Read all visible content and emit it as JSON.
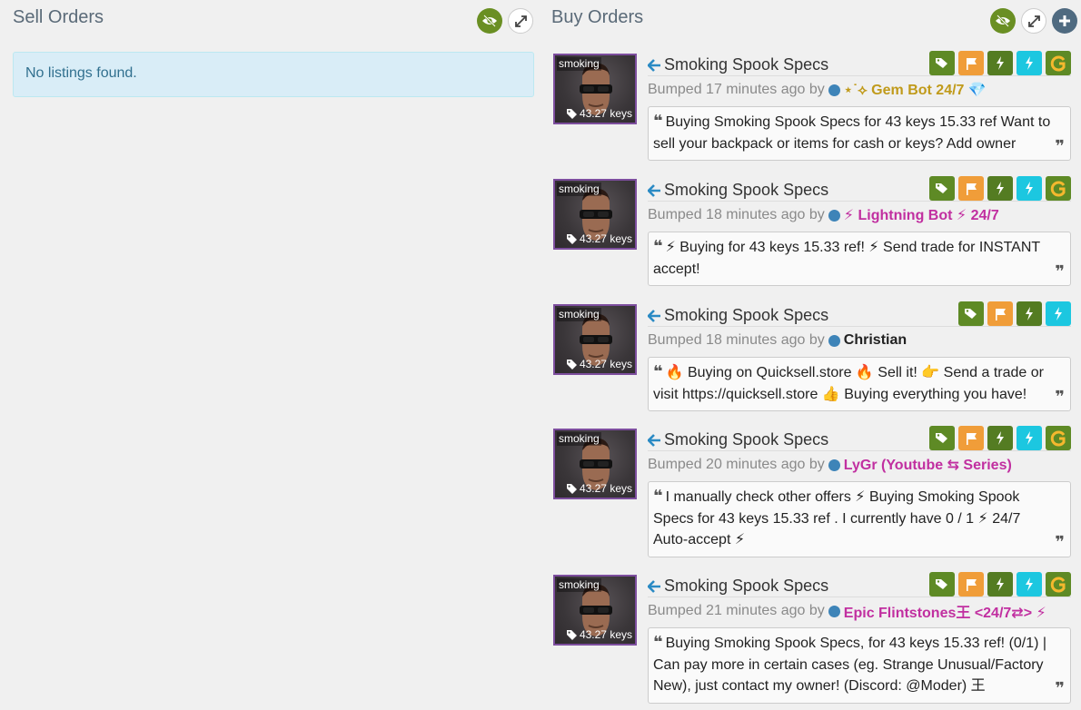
{
  "sell": {
    "title": "Sell Orders",
    "empty_message": "No listings found."
  },
  "buy": {
    "title": "Buy Orders",
    "listings": [
      {
        "item_name": "Smoking Spook Specs",
        "thumb_label": "smoking",
        "price": "43.27 keys",
        "bumped": "Bumped 17 minutes ago by",
        "user_prefix": "⋆˙⟡",
        "user_name": "Gem Bot 24/7",
        "user_suffix": "💎",
        "message": "Buying Smoking Spook Specs for 43 keys 15.33 ref Want to sell your backpack or items for cash or keys? Add owner"
      },
      {
        "item_name": "Smoking Spook Specs",
        "thumb_label": "smoking",
        "price": "43.27 keys",
        "bumped": "Bumped 18 minutes ago by",
        "user_prefix": "⚡",
        "user_name": "Lightning Bot",
        "user_suffix": "⚡ 24/7",
        "message": "⚡ Buying for 43 keys 15.33 ref! ⚡ Send trade for INSTANT accept!"
      },
      {
        "item_name": "Smoking Spook Specs",
        "thumb_label": "smoking",
        "price": "43.27 keys",
        "bumped": "Bumped 18 minutes ago by",
        "user_prefix": "",
        "user_name": "Christian",
        "user_suffix": "",
        "message": "🔥 Buying on Quicksell.store 🔥 Sell it! 👉 Send a trade or visit https://quicksell.store 👍 Buying everything you have!"
      },
      {
        "item_name": "Smoking Spook Specs",
        "thumb_label": "smoking",
        "price": "43.27 keys",
        "bumped": "Bumped 20 minutes ago by",
        "user_prefix": "",
        "user_name": "LyGr (Youtube ⇆ Series)",
        "user_suffix": "",
        "message": "I manually check other offers ⚡ Buying Smoking Spook Specs for 43 keys 15.33 ref . I currently have 0 / 1 ⚡ 24/7 Auto-accept ⚡"
      },
      {
        "item_name": "Smoking Spook Specs",
        "thumb_label": "smoking",
        "price": "43.27 keys",
        "bumped": "Bumped 21 minutes ago by",
        "user_prefix": "",
        "user_name": "Epic Flintstones王 <24/7⇄>",
        "user_suffix": "⚡",
        "message": "Buying Smoking Spook Specs, for 43 keys 15.33 ref! (0/1) | Can pay more in certain cases (eg. Strange Unusual/Factory New), just contact my owner! (Discord: @Moder) 王"
      }
    ]
  },
  "icons": {
    "visibility": "eye-slash-icon",
    "expand": "expand-icon",
    "add": "plus-icon",
    "tag": "tag-icon",
    "flag": "flag-icon",
    "bolt": "bolt-icon",
    "g_logo": "g-logo-icon",
    "arrow": "arrow-left-icon",
    "quote_open": "quote-left-icon",
    "quote_close": "quote-right-icon"
  },
  "colors": {
    "green": "#6a8f23",
    "orange": "#f09d39",
    "cyan": "#1cc7e0",
    "info_bg": "#d9edf7",
    "unusual_border": "#7d4e9e"
  }
}
